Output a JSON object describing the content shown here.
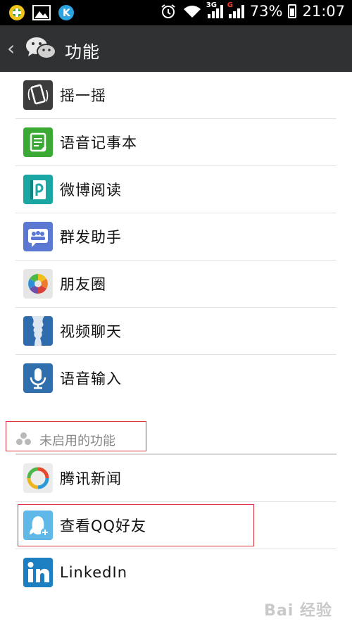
{
  "status_bar": {
    "battery": "73%",
    "time": "21:07",
    "net1": "3G",
    "net2": "G",
    "icons": [
      "app-plus-icon",
      "gallery-icon",
      "k-app-icon",
      "alarm-icon",
      "wifi-icon",
      "signal-icon",
      "battery-icon"
    ]
  },
  "header": {
    "title": "功能",
    "back_icon": "chevron-left-icon",
    "logo": "wechat-logo-icon"
  },
  "enabled_items": [
    {
      "label": "摇一摇",
      "icon": "shake-phone-icon"
    },
    {
      "label": "语音记事本",
      "icon": "voice-notepad-icon"
    },
    {
      "label": "微博阅读",
      "icon": "weibo-reader-icon"
    },
    {
      "label": "群发助手",
      "icon": "broadcast-helper-icon"
    },
    {
      "label": "朋友圈",
      "icon": "moments-icon"
    },
    {
      "label": "视频聊天",
      "icon": "video-chat-icon"
    },
    {
      "label": "语音输入",
      "icon": "microphone-icon"
    }
  ],
  "disabled_section": {
    "title": "未启用的功能",
    "icon": "disabled-plugins-icon"
  },
  "disabled_items": [
    {
      "label": "腾讯新闻",
      "icon": "tencent-news-icon"
    },
    {
      "label": "查看QQ好友",
      "icon": "qq-friends-icon"
    },
    {
      "label": "LinkedIn",
      "icon": "linkedin-icon"
    }
  ],
  "watermark": "Bai 经验",
  "colors": {
    "titlebar": "#2f3133",
    "highlight": "#d9323b",
    "wechat_green": "#45b035"
  }
}
